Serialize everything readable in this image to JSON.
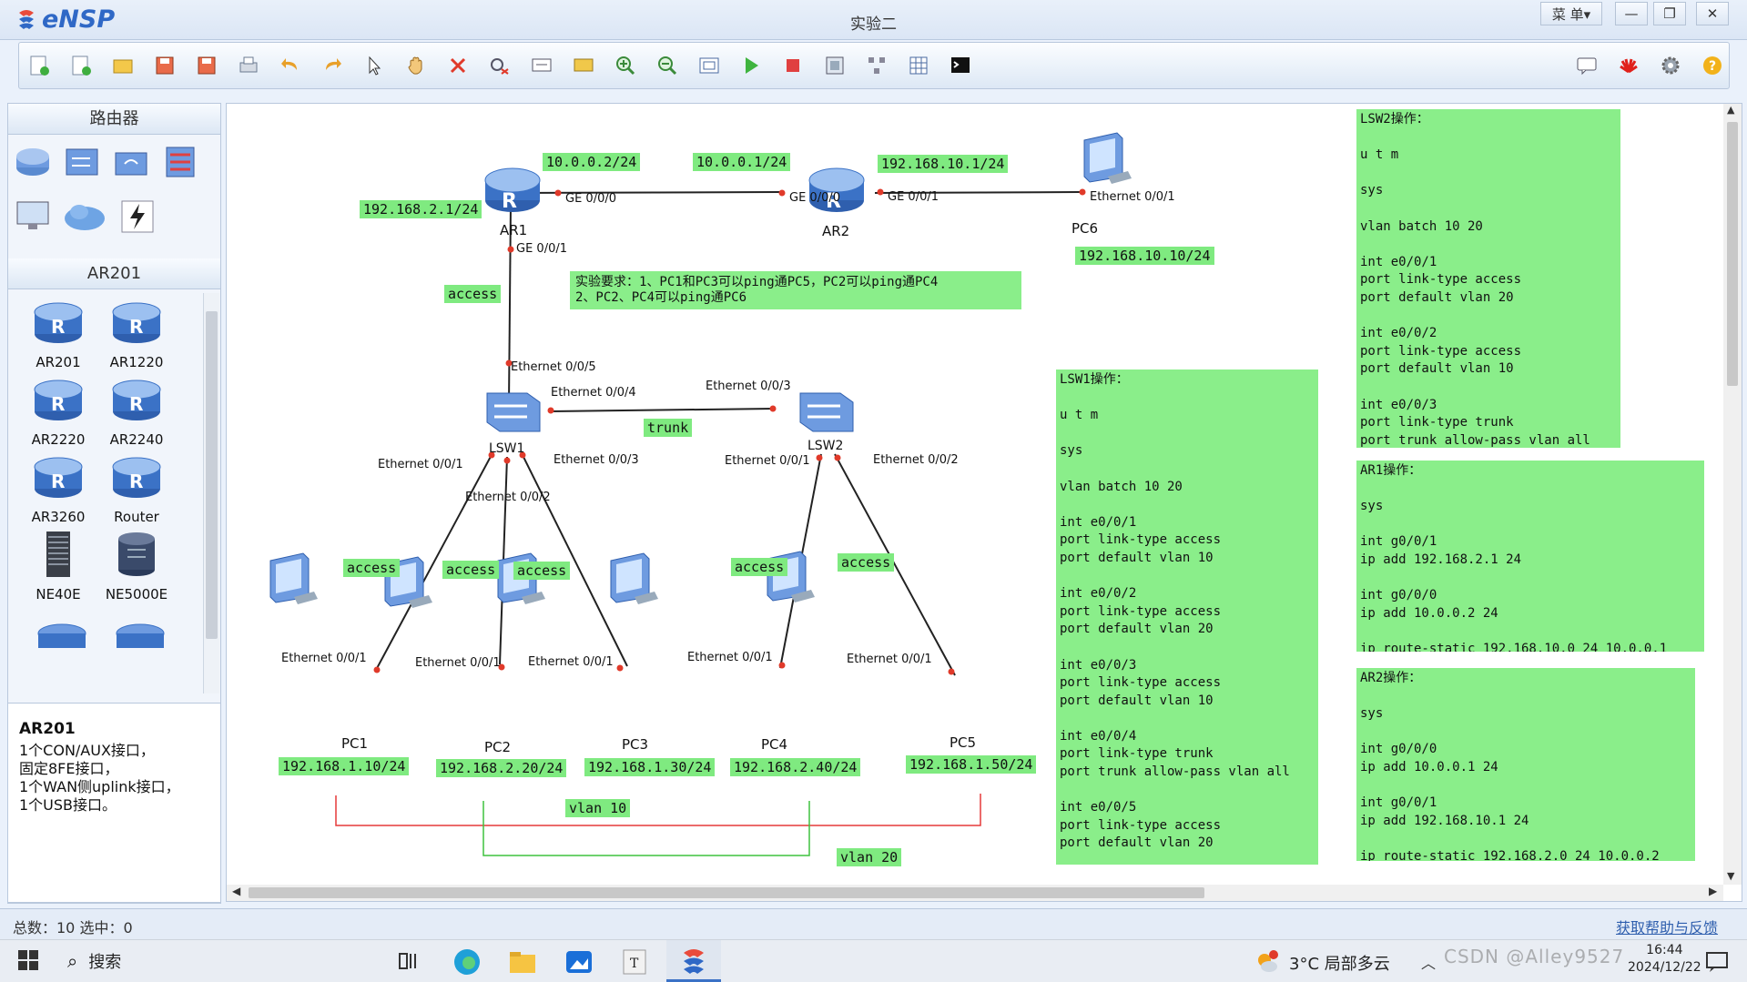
{
  "window": {
    "app_name": "eNSP",
    "title": "实验二",
    "menu_label": "菜 单▾"
  },
  "left_panel": {
    "category_title": "路由器",
    "subcategory_title": "AR201",
    "devices": [
      "AR201",
      "AR1220",
      "AR2220",
      "AR2240",
      "AR3260",
      "Router",
      "NE40E",
      "NE5000E"
    ],
    "description": {
      "name": "AR201",
      "lines": [
        "1个CON/AUX接口，",
        "固定8FE接口，",
        "1个WAN侧uplink接口，",
        "1个USB接口。"
      ]
    }
  },
  "topology": {
    "devices": {
      "ar1": "AR1",
      "ar2": "AR2",
      "lsw1": "LSW1",
      "lsw2": "LSW2",
      "pc1": "PC1",
      "pc2": "PC2",
      "pc3": "PC3",
      "pc4": "PC4",
      "pc5": "PC5",
      "pc6": "PC6"
    },
    "ports": {
      "ar1_ge000": "GE 0/0/0",
      "ar1_ge001": "GE 0/0/1",
      "ar2_ge000": "GE 0/0/0",
      "ar2_ge001": "GE 0/0/1",
      "pc6_eth": "Ethernet 0/0/1",
      "lsw1_e5": "Ethernet 0/0/5",
      "lsw1_e4": "Ethernet 0/0/4",
      "lsw1_e1": "Ethernet 0/0/1",
      "lsw1_e2": "Ethernet 0/0/2",
      "lsw1_e3": "Ethernet 0/0/3",
      "lsw2_e3": "Ethernet 0/0/3",
      "lsw2_e1": "Ethernet 0/0/1",
      "lsw2_e2": "Ethernet 0/0/2",
      "pc1_eth": "Ethernet 0/0/1",
      "pc2_eth": "Ethernet 0/0/1",
      "pc3_eth": "Ethernet 0/0/1",
      "pc4_eth": "Ethernet 0/0/1",
      "pc5_eth": "Ethernet 0/0/1"
    },
    "labels": {
      "ar1_lan": "192.168.2.1/24",
      "ar1_wan": "10.0.0.2/24",
      "ar2_wan": "10.0.0.1/24",
      "ar2_lan": "192.168.10.1/24",
      "pc6_ip": "192.168.10.10/24",
      "ar1_link": "access",
      "trunk": "trunk",
      "pc1_link": "access",
      "pc2_link": "access",
      "pc3_link": "access",
      "pc4_link": "access",
      "pc5_link": "access",
      "pc1_ip": "192.168.1.10/24",
      "pc2_ip": "192.168.2.20/24",
      "pc3_ip": "192.168.1.30/24",
      "pc4_ip": "192.168.2.40/24",
      "pc5_ip": "192.168.1.50/24",
      "vlan10": "vlan 10",
      "vlan20": "vlan 20"
    },
    "requirement": [
      "实验要求：1、PC1和PC3可以ping通PC5，PC2可以ping通PC4",
      "2、PC2、PC4可以ping通PC6"
    ],
    "notes": {
      "lsw1": "LSW1操作：\n\nu t m\n\nsys\n\nvlan batch 10 20\n\nint e0/0/1\nport link-type access\nport default vlan 10\n\nint e0/0/2\nport link-type access\nport default vlan 20\n\nint e0/0/3\nport link-type access\nport default vlan 10\n\nint e0/0/4\nport link-type trunk\nport trunk allow-pass vlan all\n\nint e0/0/5\nport link-type access\nport default vlan 20",
      "lsw2": "LSW2操作：\n\nu t m\n\nsys\n\nvlan batch 10 20\n\nint e0/0/1\nport link-type access\nport default vlan 20\n\nint e0/0/2\nport link-type access\nport default vlan 10\n\nint e0/0/3\nport link-type trunk\nport trunk allow-pass vlan all",
      "ar1": "AR1操作：\n\nsys\n\nint g0/0/1\nip add 192.168.2.1 24\n\nint g0/0/0\nip add 10.0.0.2 24\n\nip route-static 192.168.10.0 24 10.0.0.1",
      "ar2": "AR2操作：\n\nsys\n\nint g0/0/0\nip add 10.0.0.1 24\n\nint g0/0/1\nip add 192.168.10.1 24\n\nip route-static 192.168.2.0 24 10.0.0.2"
    }
  },
  "status": {
    "counts": "总数：10 选中：0",
    "help_link": "获取帮助与反馈"
  },
  "taskbar": {
    "search": "搜索",
    "weather": "3°C  局部多云",
    "time": "16:44",
    "date": "2024/12/22",
    "watermark": "CSDN @Alley9527"
  },
  "colors": {
    "label_green": "#7fea80",
    "vlan10_line": "#e53a3a",
    "vlan20_line": "#3ec23e",
    "accent_blue": "#2f68c6"
  }
}
